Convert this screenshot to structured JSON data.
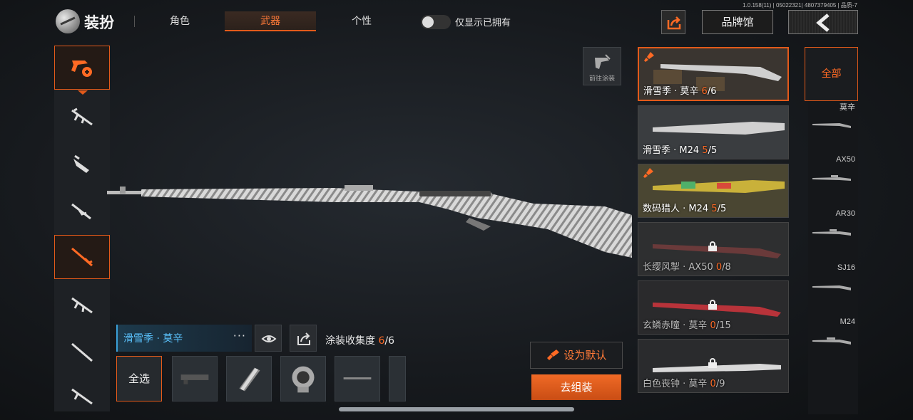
{
  "version": "1.0.158(11) | 05022321| 4807379405 | 品质-7",
  "header": {
    "title": "装扮",
    "tabs": [
      {
        "label": "角色",
        "active": false
      },
      {
        "label": "武器",
        "active": true
      },
      {
        "label": "个性",
        "active": false
      }
    ],
    "toggle_label": "仅显示已拥有",
    "toggle_on": false,
    "brand_label": "品牌馆"
  },
  "go_skin_label": "前往涂装",
  "current_skin": {
    "name": "滑雪季 · 莫辛",
    "more": "···",
    "collection_label": "涂装收集度",
    "owned": "6",
    "total": "/6"
  },
  "parts": {
    "select_all_label": "全选"
  },
  "actions": {
    "set_default_label": "设为默认",
    "assemble_label": "去组装"
  },
  "skins": [
    {
      "name": "滑雪季 · 莫辛",
      "owned": "6",
      "total": "/6",
      "locked": false,
      "active": true
    },
    {
      "name": "滑雪季 · M24",
      "owned": "5",
      "total": "/5",
      "locked": false,
      "active": false
    },
    {
      "name": "数码猎人 · M24",
      "owned": "5",
      "total": "/5",
      "locked": false,
      "active": false
    },
    {
      "name": "长缨风掣 · AX50",
      "owned": "0",
      "total": "/8",
      "locked": true,
      "active": false
    },
    {
      "name": "玄鳞赤瞳 · 莫辛",
      "owned": "0",
      "total": "/15",
      "locked": true,
      "active": false
    },
    {
      "name": "白色丧钟 · 莫辛",
      "owned": "0",
      "total": "/9",
      "locked": true,
      "active": false
    }
  ],
  "filters": {
    "all_label": "全部",
    "weapons": [
      "莫辛",
      "AX50",
      "AR30",
      "SJ16",
      "M24"
    ]
  },
  "colors": {
    "accent": "#e35a1a",
    "skin_name_blue": "#5bc4ff"
  }
}
